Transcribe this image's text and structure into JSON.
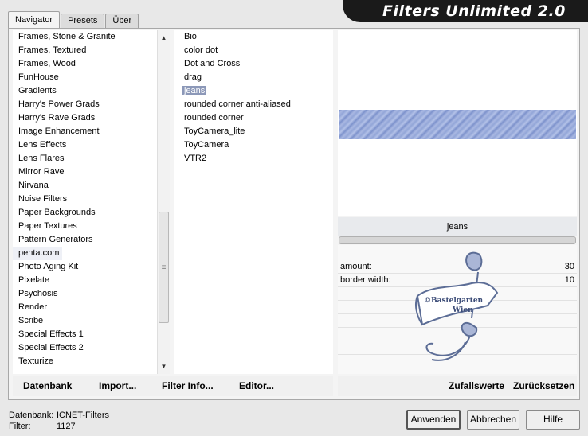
{
  "tabs": [
    "Navigator",
    "Presets",
    "Über"
  ],
  "title": "Filters Unlimited 2.0",
  "categories": [
    "Frames, Stone & Granite",
    "Frames, Textured",
    "Frames, Wood",
    "FunHouse",
    "Gradients",
    "Harry's Power Grads",
    "Harry's Rave Grads",
    "Image Enhancement",
    "Lens Effects",
    "Lens Flares",
    "Mirror Rave",
    "Nirvana",
    "Noise Filters",
    "Paper Backgrounds",
    "Paper Textures",
    "Pattern Generators",
    "penta.com",
    "Photo Aging Kit",
    "Pixelate",
    "Psychosis",
    "Render",
    "Scribe",
    "Special Effects 1",
    "Special Effects 2",
    "Texturize"
  ],
  "highlighted_category": "penta.com",
  "filters": [
    "Bio",
    "color dot",
    "Dot and Cross",
    "drag",
    "jeans",
    "rounded corner anti-aliased",
    "rounded corner",
    "ToyCamera_lite",
    "ToyCamera",
    "VTR2"
  ],
  "selected_filter": "jeans",
  "preview": {
    "filter_name": "jeans"
  },
  "params": [
    {
      "label": "amount:",
      "value": "30"
    },
    {
      "label": "border width:",
      "value": "10"
    }
  ],
  "watermark": {
    "line1": "©Bastelgarten",
    "line2": "Wien"
  },
  "toolbar_left": {
    "datenbank": "Datenbank",
    "import": "Import...",
    "filter_info": "Filter Info...",
    "editor": "Editor..."
  },
  "toolbar_right": {
    "random": "Zufallswerte",
    "reset": "Zurücksetzen"
  },
  "status": {
    "db_label": "Datenbank:",
    "db_value": "ICNET-Filters",
    "filter_label": "Filter:",
    "filter_value": "1127"
  },
  "buttons": {
    "apply": "Anwenden",
    "cancel": "Abbrechen",
    "help": "Hilfe"
  },
  "colors": {
    "selection": "#8c98b8",
    "title_bg": "#1a1a1a",
    "jeans": "#8fa2d6"
  },
  "scroll_icons": [
    "up-arrow-icon",
    "down-arrow-icon",
    "grip-icon"
  ]
}
